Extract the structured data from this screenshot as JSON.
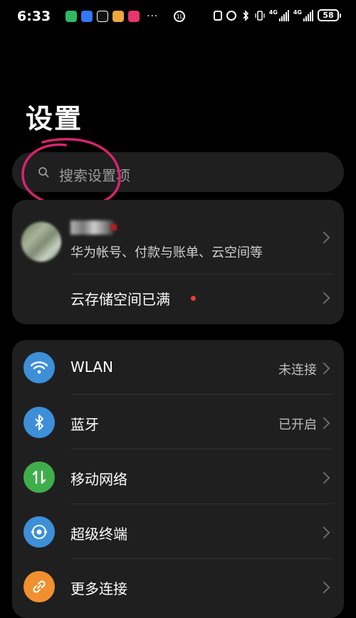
{
  "status_bar": {
    "time": "6:33",
    "battery": "58",
    "network_label": "4G",
    "more": "···",
    "circle_label": "1L",
    "app_icon_colors": [
      "#2fb964",
      "#3478f6",
      "#111111",
      "#f0a640",
      "#e8356b"
    ]
  },
  "page": {
    "title": "设置"
  },
  "search": {
    "placeholder": "搜索设置项"
  },
  "account": {
    "subtitle": "华为帐号、付款与账单、云空间等",
    "cloud_storage_label": "云存储空间已满",
    "cloud_storage_dot_color": "#e8412f"
  },
  "connections": [
    {
      "id": "wlan",
      "label": "WLAN",
      "status": "未连接",
      "icon": "wifi-icon",
      "color": "#3d8fd8"
    },
    {
      "id": "bluetooth",
      "label": "蓝牙",
      "status": "已开启",
      "icon": "bluetooth-icon",
      "color": "#3d8fd8"
    },
    {
      "id": "mobile-network",
      "label": "移动网络",
      "status": "",
      "icon": "mobile-data-icon",
      "color": "#3fae4a"
    },
    {
      "id": "super-device",
      "label": "超级终端",
      "status": "",
      "icon": "super-device-icon",
      "color": "#3d8fd8"
    },
    {
      "id": "more-connections",
      "label": "更多连接",
      "status": "",
      "icon": "link-icon",
      "color": "#f0902f"
    }
  ],
  "colors": {
    "background": "#000000",
    "card": "#1f1f1f",
    "annotation": "#d6246e"
  }
}
